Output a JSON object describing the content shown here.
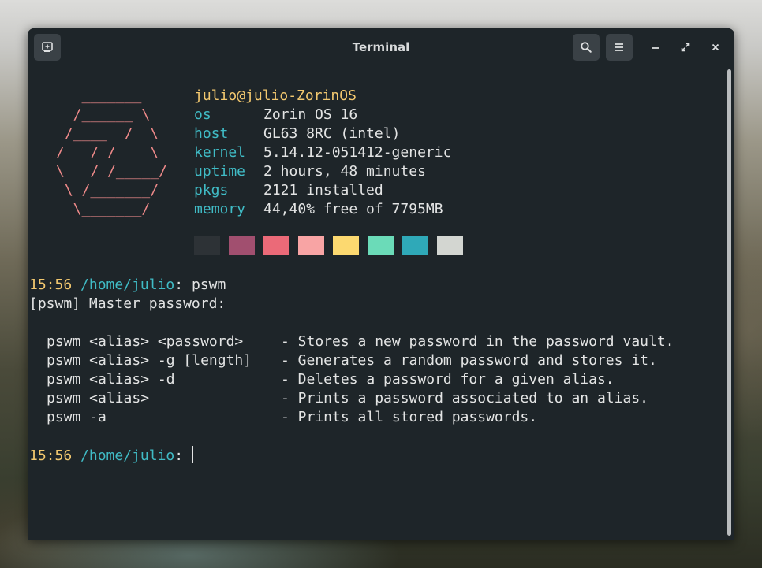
{
  "window": {
    "title": "Terminal",
    "new_tab_icon": "new-tab-icon",
    "search_icon": "search-icon",
    "menu_icon": "hamburger-menu-icon",
    "minimize_icon": "minimize-icon",
    "maximize_icon": "maximize-icon",
    "close_icon": "close-icon"
  },
  "neofetch": {
    "logo": [
      "   _______",
      "  /______ \\",
      " /____  /  \\",
      "/   / /    \\",
      "\\   / /_____/",
      " \\ /_______/",
      "  \\_______/"
    ],
    "user_host": "julio@julio-ZorinOS",
    "rows": [
      {
        "key": "os",
        "value": "Zorin OS 16"
      },
      {
        "key": "host",
        "value": "GL63 8RC (intel)"
      },
      {
        "key": "kernel",
        "value": "5.14.12-051412-generic"
      },
      {
        "key": "uptime",
        "value": "2 hours, 48 minutes"
      },
      {
        "key": "pkgs",
        "value": "2121 installed"
      },
      {
        "key": "memory",
        "value": "44,40% free of 7795MB"
      }
    ],
    "palette": [
      "#2d3236",
      "#a14f6f",
      "#eb6a78",
      "#f8a4a4",
      "#fcd970",
      "#6bdbb8",
      "#2fa9b8",
      "#d3d6d1"
    ]
  },
  "session": {
    "prompt1": {
      "time": "15:56",
      "path": "/home/julio",
      "sep": ":",
      "command": "pswm"
    },
    "master_line": "[pswm] Master password:",
    "usage": [
      {
        "cmd": "pswm <alias> <password>",
        "desc": "- Stores a new password in the password vault."
      },
      {
        "cmd": "pswm <alias> -g [length]",
        "desc": "- Generates a random password and stores it."
      },
      {
        "cmd": "pswm <alias> -d",
        "desc": "- Deletes a password for a given alias."
      },
      {
        "cmd": "pswm <alias>",
        "desc": "- Prints a password associated to an alias."
      },
      {
        "cmd": "pswm -a",
        "desc": "- Prints all stored passwords."
      }
    ],
    "prompt2": {
      "time": "15:56",
      "path": "/home/julio",
      "sep": ":",
      "command": ""
    }
  },
  "theme": {
    "background": "#1e2529",
    "yellow": "#f3c86f",
    "teal": "#40bcc6",
    "red": "#ef8a8a"
  }
}
